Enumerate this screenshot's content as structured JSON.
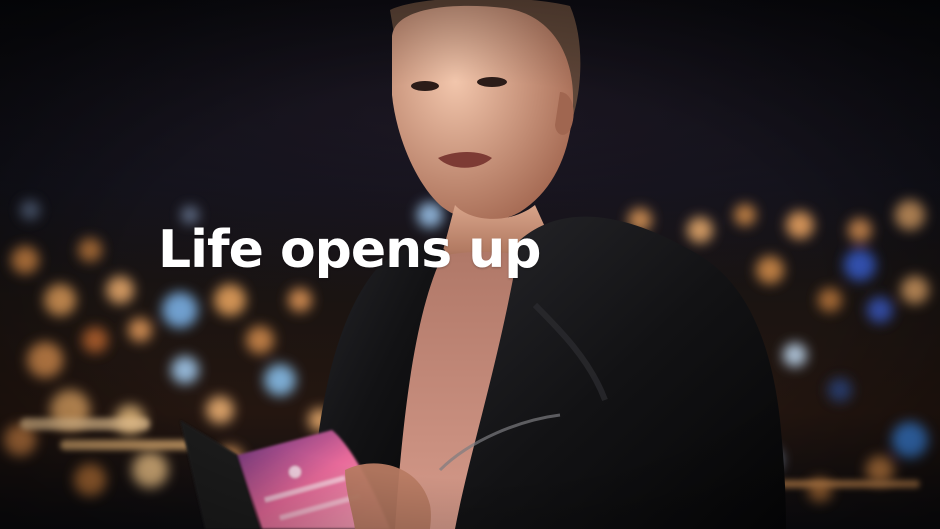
{
  "headline": "Life opens up",
  "colors": {
    "headline": "#ffffff",
    "sky": "#0b0d14",
    "bokeh_warm": "#f0a050",
    "bokeh_blue": "#4a7fd8",
    "phone_screen_pink": "#e86a9a",
    "jacket": "#121214"
  }
}
